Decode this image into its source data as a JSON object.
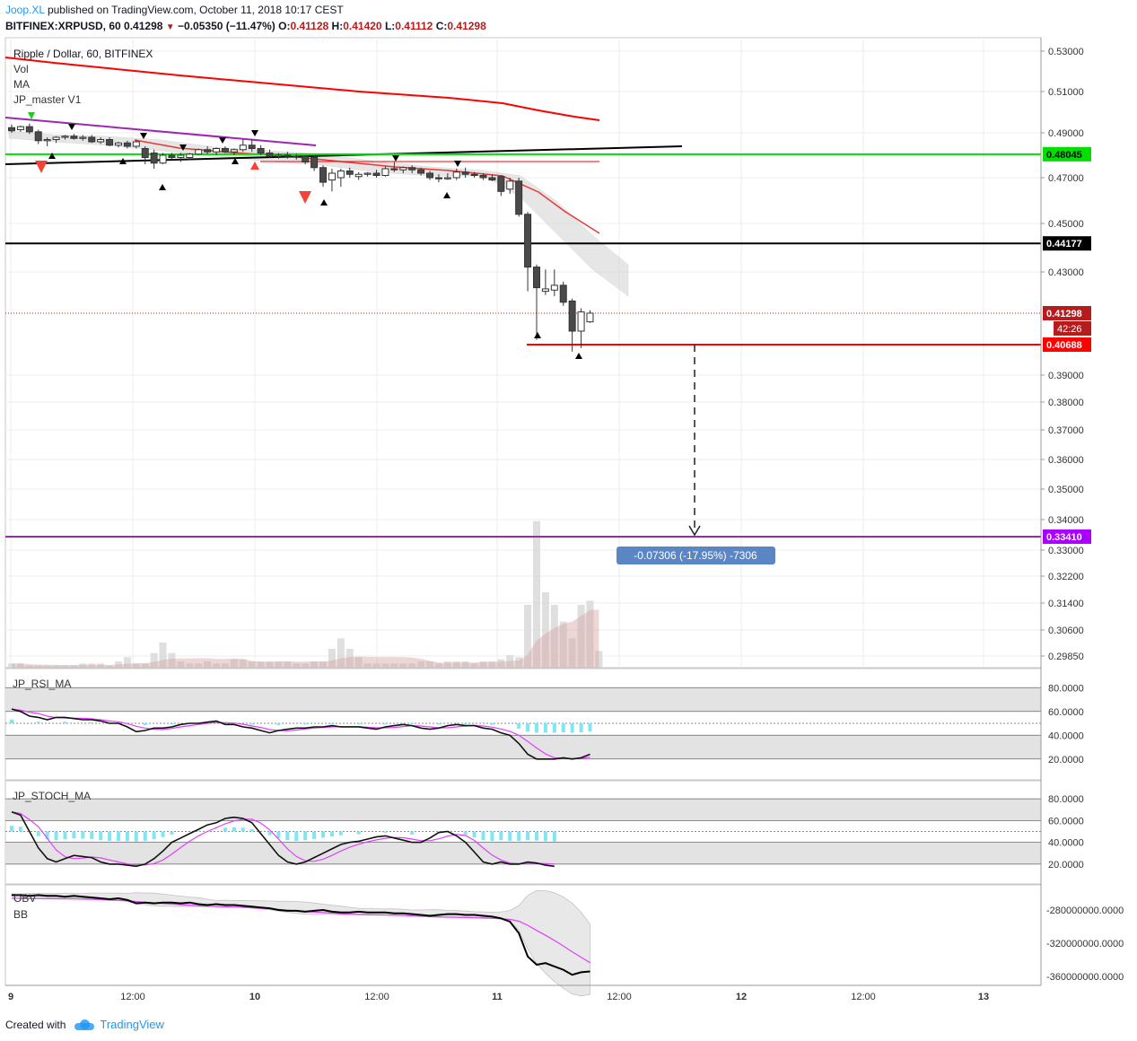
{
  "header": {
    "author": "Joop.XL",
    "published_text": "published on TradingView.com, October 11, 2018 10:17 CEST",
    "symbol": "BITFINEX:XRPUSD, 60",
    "last": "0.41298",
    "change": "−0.05350 (−11.47%)",
    "o_label": "O:",
    "o_val": "0.41128",
    "h_label": "H:",
    "h_val": "0.41420",
    "l_label": "L:",
    "l_val": "0.41112",
    "c_label": "C:",
    "c_val": "0.41298"
  },
  "legend": {
    "title": "Ripple / Dollar, 60, BITFINEX",
    "vol": "Vol",
    "ma": "MA",
    "indicator": "JP_master V1",
    "rsi": "JP_RSI_MA",
    "stoch": "JP_STOCH_MA",
    "obv": "OBV",
    "bb": "BB"
  },
  "price_axis": {
    "ticks": [
      "0.53000",
      "0.51000",
      "0.49000",
      "0.47000",
      "0.45000",
      "0.43000",
      "0.39000",
      "0.38000",
      "0.37000",
      "0.36000",
      "0.35000",
      "0.34000",
      "0.33000",
      "0.32200",
      "0.31400",
      "0.30600",
      "0.29850"
    ],
    "labels": {
      "green": "0.48045",
      "black": "0.44177",
      "last": "0.41298",
      "countdown": "42:26",
      "red": "0.40688",
      "purple": "0.33410"
    }
  },
  "measure_label": "-0.07306 (-17.95%) -7306",
  "rsi_axis": [
    "80.0000",
    "60.0000",
    "40.0000",
    "20.0000"
  ],
  "stoch_axis": [
    "80.0000",
    "60.0000",
    "40.0000",
    "20.0000"
  ],
  "obv_axis": [
    "-280000000.0000",
    "-320000000.0000",
    "-360000000.0000"
  ],
  "time_axis": [
    "9",
    "12:00",
    "10",
    "12:00",
    "11",
    "12:00",
    "12",
    "12:00",
    "13"
  ],
  "colors": {
    "up_candle": "#ffffff",
    "down_candle": "#4a4a4a",
    "green_line": "#00e000",
    "red_line": "#ff0000",
    "purple_line": "#9c27b0",
    "volume": "#d9d9d9",
    "tv_blue": "#2196f3"
  },
  "footer": {
    "created_with": "Created with",
    "brand": "TradingView"
  },
  "chart_data": {
    "type": "candlestick",
    "title": "Ripple / Dollar, 60, BITFINEX",
    "x_ticks": [
      "9",
      "12:00",
      "10",
      "12:00",
      "11",
      "12:00",
      "12",
      "12:00",
      "13"
    ],
    "candles": [
      {
        "o": 0.4925,
        "h": 0.494,
        "l": 0.49,
        "c": 0.491
      },
      {
        "o": 0.4915,
        "h": 0.4935,
        "l": 0.4905,
        "c": 0.493
      },
      {
        "o": 0.493,
        "h": 0.4945,
        "l": 0.4895,
        "c": 0.4905
      },
      {
        "o": 0.4905,
        "h": 0.4915,
        "l": 0.485,
        "c": 0.4865
      },
      {
        "o": 0.4865,
        "h": 0.488,
        "l": 0.484,
        "c": 0.487
      },
      {
        "o": 0.487,
        "h": 0.4885,
        "l": 0.4855,
        "c": 0.488
      },
      {
        "o": 0.488,
        "h": 0.489,
        "l": 0.487,
        "c": 0.4885
      },
      {
        "o": 0.4885,
        "h": 0.4895,
        "l": 0.487,
        "c": 0.4875
      },
      {
        "o": 0.4875,
        "h": 0.489,
        "l": 0.4865,
        "c": 0.488
      },
      {
        "o": 0.488,
        "h": 0.489,
        "l": 0.4855,
        "c": 0.486
      },
      {
        "o": 0.486,
        "h": 0.488,
        "l": 0.485,
        "c": 0.487
      },
      {
        "o": 0.487,
        "h": 0.488,
        "l": 0.484,
        "c": 0.4845
      },
      {
        "o": 0.4845,
        "h": 0.486,
        "l": 0.4835,
        "c": 0.4855
      },
      {
        "o": 0.4855,
        "h": 0.4865,
        "l": 0.483,
        "c": 0.484
      },
      {
        "o": 0.484,
        "h": 0.487,
        "l": 0.483,
        "c": 0.486
      },
      {
        "o": 0.483,
        "h": 0.484,
        "l": 0.476,
        "c": 0.479
      },
      {
        "o": 0.481,
        "h": 0.4825,
        "l": 0.474,
        "c": 0.4765
      },
      {
        "o": 0.4765,
        "h": 0.481,
        "l": 0.476,
        "c": 0.48
      },
      {
        "o": 0.48,
        "h": 0.481,
        "l": 0.478,
        "c": 0.479
      },
      {
        "o": 0.479,
        "h": 0.481,
        "l": 0.477,
        "c": 0.48
      },
      {
        "o": 0.479,
        "h": 0.481,
        "l": 0.478,
        "c": 0.4805
      },
      {
        "o": 0.4805,
        "h": 0.483,
        "l": 0.48,
        "c": 0.4825
      },
      {
        "o": 0.4825,
        "h": 0.484,
        "l": 0.4805,
        "c": 0.4815
      },
      {
        "o": 0.4815,
        "h": 0.4835,
        "l": 0.48,
        "c": 0.483
      },
      {
        "o": 0.483,
        "h": 0.484,
        "l": 0.481,
        "c": 0.4815
      },
      {
        "o": 0.4815,
        "h": 0.483,
        "l": 0.48,
        "c": 0.4825
      },
      {
        "o": 0.4825,
        "h": 0.487,
        "l": 0.4815,
        "c": 0.4845
      },
      {
        "o": 0.4845,
        "h": 0.487,
        "l": 0.4815,
        "c": 0.483
      },
      {
        "o": 0.483,
        "h": 0.4845,
        "l": 0.48,
        "c": 0.481
      },
      {
        "o": 0.481,
        "h": 0.4825,
        "l": 0.479,
        "c": 0.4795
      },
      {
        "o": 0.4795,
        "h": 0.481,
        "l": 0.4785,
        "c": 0.48
      },
      {
        "o": 0.48,
        "h": 0.4815,
        "l": 0.4785,
        "c": 0.4795
      },
      {
        "o": 0.4795,
        "h": 0.4805,
        "l": 0.478,
        "c": 0.4795
      },
      {
        "o": 0.4795,
        "h": 0.48,
        "l": 0.476,
        "c": 0.477
      },
      {
        "o": 0.479,
        "h": 0.48,
        "l": 0.473,
        "c": 0.4745
      },
      {
        "o": 0.4745,
        "h": 0.4755,
        "l": 0.466,
        "c": 0.468
      },
      {
        "o": 0.469,
        "h": 0.474,
        "l": 0.464,
        "c": 0.472
      },
      {
        "o": 0.47,
        "h": 0.474,
        "l": 0.466,
        "c": 0.473
      },
      {
        "o": 0.473,
        "h": 0.4745,
        "l": 0.47,
        "c": 0.4715
      },
      {
        "o": 0.4705,
        "h": 0.4725,
        "l": 0.469,
        "c": 0.4715
      },
      {
        "o": 0.4715,
        "h": 0.4725,
        "l": 0.4705,
        "c": 0.472
      },
      {
        "o": 0.472,
        "h": 0.4735,
        "l": 0.47,
        "c": 0.471
      },
      {
        "o": 0.471,
        "h": 0.475,
        "l": 0.4705,
        "c": 0.474
      },
      {
        "o": 0.474,
        "h": 0.477,
        "l": 0.4725,
        "c": 0.4735
      },
      {
        "o": 0.4735,
        "h": 0.475,
        "l": 0.472,
        "c": 0.4745
      },
      {
        "o": 0.4745,
        "h": 0.4755,
        "l": 0.472,
        "c": 0.4735
      },
      {
        "o": 0.4735,
        "h": 0.4745,
        "l": 0.471,
        "c": 0.472
      },
      {
        "o": 0.472,
        "h": 0.473,
        "l": 0.469,
        "c": 0.47
      },
      {
        "o": 0.47,
        "h": 0.4715,
        "l": 0.468,
        "c": 0.4695
      },
      {
        "o": 0.4695,
        "h": 0.472,
        "l": 0.469,
        "c": 0.47
      },
      {
        "o": 0.47,
        "h": 0.474,
        "l": 0.469,
        "c": 0.4725
      },
      {
        "o": 0.4725,
        "h": 0.4745,
        "l": 0.47,
        "c": 0.4715
      },
      {
        "o": 0.4715,
        "h": 0.4725,
        "l": 0.47,
        "c": 0.471
      },
      {
        "o": 0.471,
        "h": 0.472,
        "l": 0.469,
        "c": 0.47
      },
      {
        "o": 0.47,
        "h": 0.4715,
        "l": 0.4685,
        "c": 0.469
      },
      {
        "o": 0.4705,
        "h": 0.471,
        "l": 0.462,
        "c": 0.464
      },
      {
        "o": 0.465,
        "h": 0.47,
        "l": 0.463,
        "c": 0.4685
      },
      {
        "o": 0.4685,
        "h": 0.47,
        "l": 0.453,
        "c": 0.454
      },
      {
        "o": 0.454,
        "h": 0.455,
        "l": 0.422,
        "c": 0.432
      },
      {
        "o": 0.432,
        "h": 0.433,
        "l": 0.4078,
        "c": 0.4235
      },
      {
        "o": 0.422,
        "h": 0.431,
        "l": 0.4205,
        "c": 0.423
      },
      {
        "o": 0.4225,
        "h": 0.431,
        "l": 0.42,
        "c": 0.4245
      },
      {
        "o": 0.4245,
        "h": 0.426,
        "l": 0.416,
        "c": 0.4175
      },
      {
        "o": 0.418,
        "h": 0.419,
        "l": 0.403,
        "c": 0.4095
      },
      {
        "o": 0.4095,
        "h": 0.415,
        "l": 0.405,
        "c": 0.4135
      },
      {
        "o": 0.4113,
        "h": 0.4142,
        "l": 0.4111,
        "c": 0.413
      }
    ],
    "volume": [
      2,
      2,
      1,
      1,
      1,
      1,
      1,
      1,
      2,
      2,
      2,
      1,
      3,
      5,
      2,
      2,
      7,
      12,
      7,
      3,
      2,
      2,
      3,
      2,
      2,
      4,
      4,
      3,
      3,
      3,
      3,
      3,
      2,
      2,
      3,
      3,
      9,
      14,
      9,
      5,
      2,
      2,
      2,
      2,
      2,
      2,
      3,
      3,
      2,
      3,
      3,
      3,
      2,
      3,
      3,
      4,
      6,
      5,
      30,
      70,
      36,
      30,
      22,
      14,
      30,
      32,
      8
    ],
    "horizontal_lines": [
      {
        "name": "green",
        "value": 0.48045
      },
      {
        "name": "black",
        "value": 0.44177
      },
      {
        "name": "red",
        "value": 0.40688
      },
      {
        "name": "purple",
        "value": 0.3341
      }
    ],
    "measure": {
      "from": 0.40688,
      "to": 0.3341,
      "label": "-0.07306 (-17.95%) -7306"
    },
    "rsi": {
      "ylim": [
        0,
        100
      ],
      "values": [
        62,
        60,
        56,
        55,
        53,
        55,
        55,
        54,
        53,
        53,
        52,
        50,
        50,
        47,
        43,
        44,
        46,
        46,
        47,
        49,
        50,
        50,
        51,
        52,
        49,
        49,
        47,
        46,
        44,
        42,
        44,
        45,
        46,
        46,
        47,
        47,
        48,
        47,
        47,
        47,
        46,
        45,
        47,
        48,
        49,
        48,
        46,
        45,
        46,
        48,
        49,
        48,
        48,
        46,
        45,
        42,
        40,
        33,
        24,
        20,
        20,
        20,
        21,
        20,
        21,
        24
      ]
    },
    "stoch": {
      "ylim": [
        0,
        100
      ],
      "values": [
        68,
        65,
        50,
        35,
        25,
        22,
        25,
        28,
        27,
        26,
        22,
        20,
        20,
        19,
        18,
        20,
        25,
        32,
        40,
        44,
        48,
        52,
        56,
        58,
        62,
        63,
        62,
        58,
        48,
        38,
        28,
        22,
        20,
        22,
        26,
        30,
        34,
        38,
        40,
        41,
        43,
        45,
        46,
        44,
        42,
        40,
        40,
        44,
        49,
        50,
        46,
        40,
        31,
        22,
        20,
        22,
        20,
        20,
        22,
        21,
        19,
        18
      ]
    },
    "obv": {
      "values": [
        -262,
        -262,
        -263,
        -262,
        -263,
        -263,
        -264,
        -263,
        -264,
        -265,
        -266,
        -267,
        -266,
        -268,
        -272,
        -271,
        -272,
        -271,
        -271,
        -272,
        -271,
        -273,
        -274,
        -273,
        -274,
        -274,
        -275,
        -276,
        -277,
        -278,
        -280,
        -281,
        -281,
        -282,
        -281,
        -280,
        -282,
        -283,
        -283,
        -282,
        -283,
        -283,
        -283,
        -284,
        -284,
        -285,
        -286,
        -287,
        -286,
        -285,
        -285,
        -286,
        -286,
        -287,
        -288,
        -290,
        -294,
        -308,
        -336,
        -346,
        -344,
        -348,
        -352,
        -358,
        -355,
        -354
      ]
    }
  }
}
